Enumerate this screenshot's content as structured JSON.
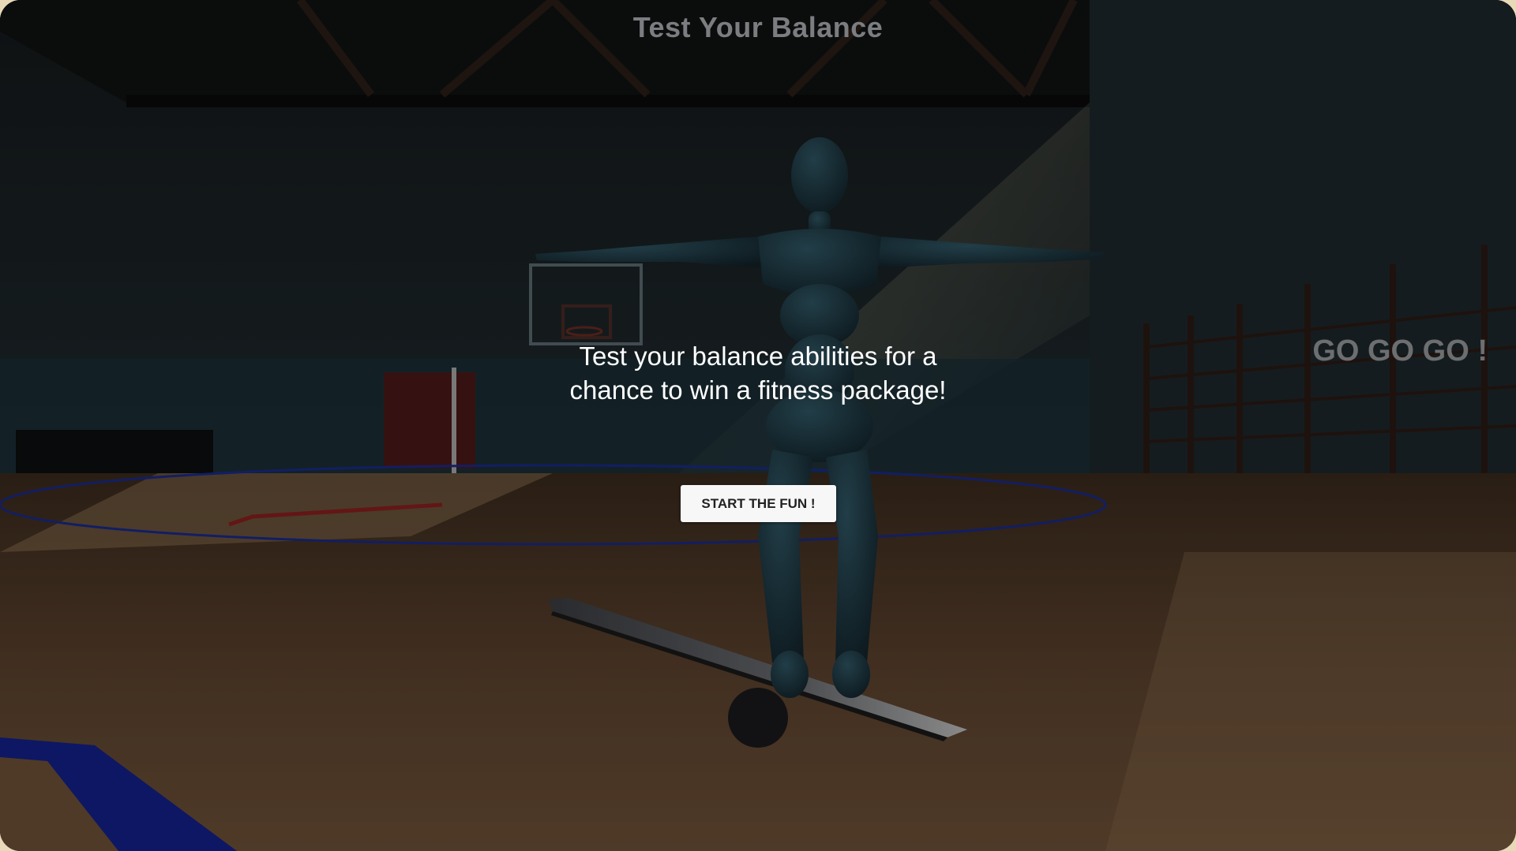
{
  "game": {
    "title": "Test Your Balance",
    "side_cheer": "GO GO GO !",
    "intro_line1": "Test your balance abilities for a",
    "intro_line2": "chance to win a fitness package!",
    "start_button_label": "START THE FUN !"
  },
  "scene": {
    "setting": "indoor gym",
    "character": "mannequin",
    "prop": "balance-board",
    "colors": {
      "floor": "#5e4430",
      "wall": "#1c2a2e",
      "mannequin": "#1f3b44",
      "board": "#4a4c50",
      "court-line-blue": "#1a2a8a",
      "court-line-red": "#8a1f1f"
    }
  }
}
